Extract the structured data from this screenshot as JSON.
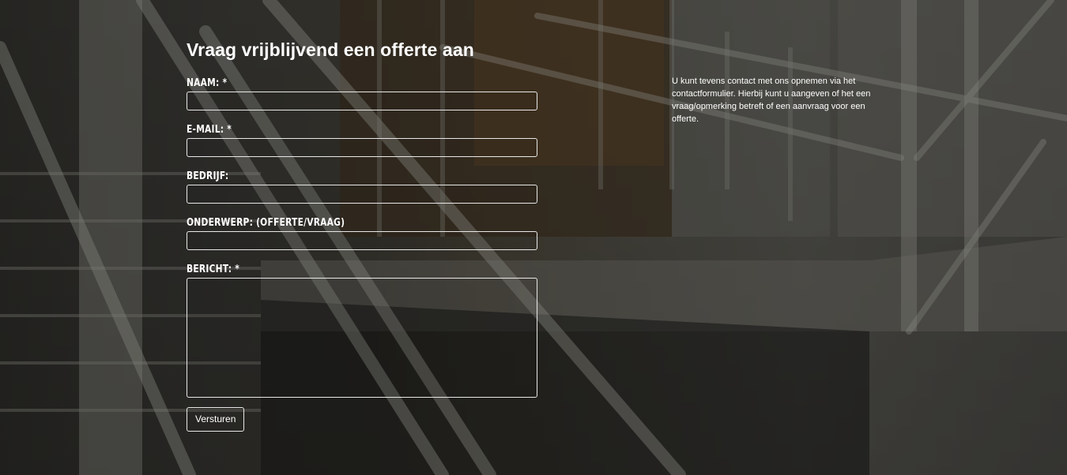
{
  "form": {
    "title": "Vraag vrijblijvend een offerte aan",
    "fields": [
      {
        "label": "NAAM: *",
        "value": ""
      },
      {
        "label": "E-MAIL: *",
        "value": ""
      },
      {
        "label": "BEDRIJF:",
        "value": ""
      },
      {
        "label": "ONDERWERP: (OFFERTE/VRAAG)",
        "value": ""
      },
      {
        "label": "BERICHT: *",
        "value": ""
      }
    ],
    "submit_label": "Versturen"
  },
  "aside": {
    "text": "U kunt tevens contact met ons opnemen via het contactformulier. Hierbij kunt u aangeven of het een vraag/opmerking betreft of een aanvraag voor een offerte."
  }
}
